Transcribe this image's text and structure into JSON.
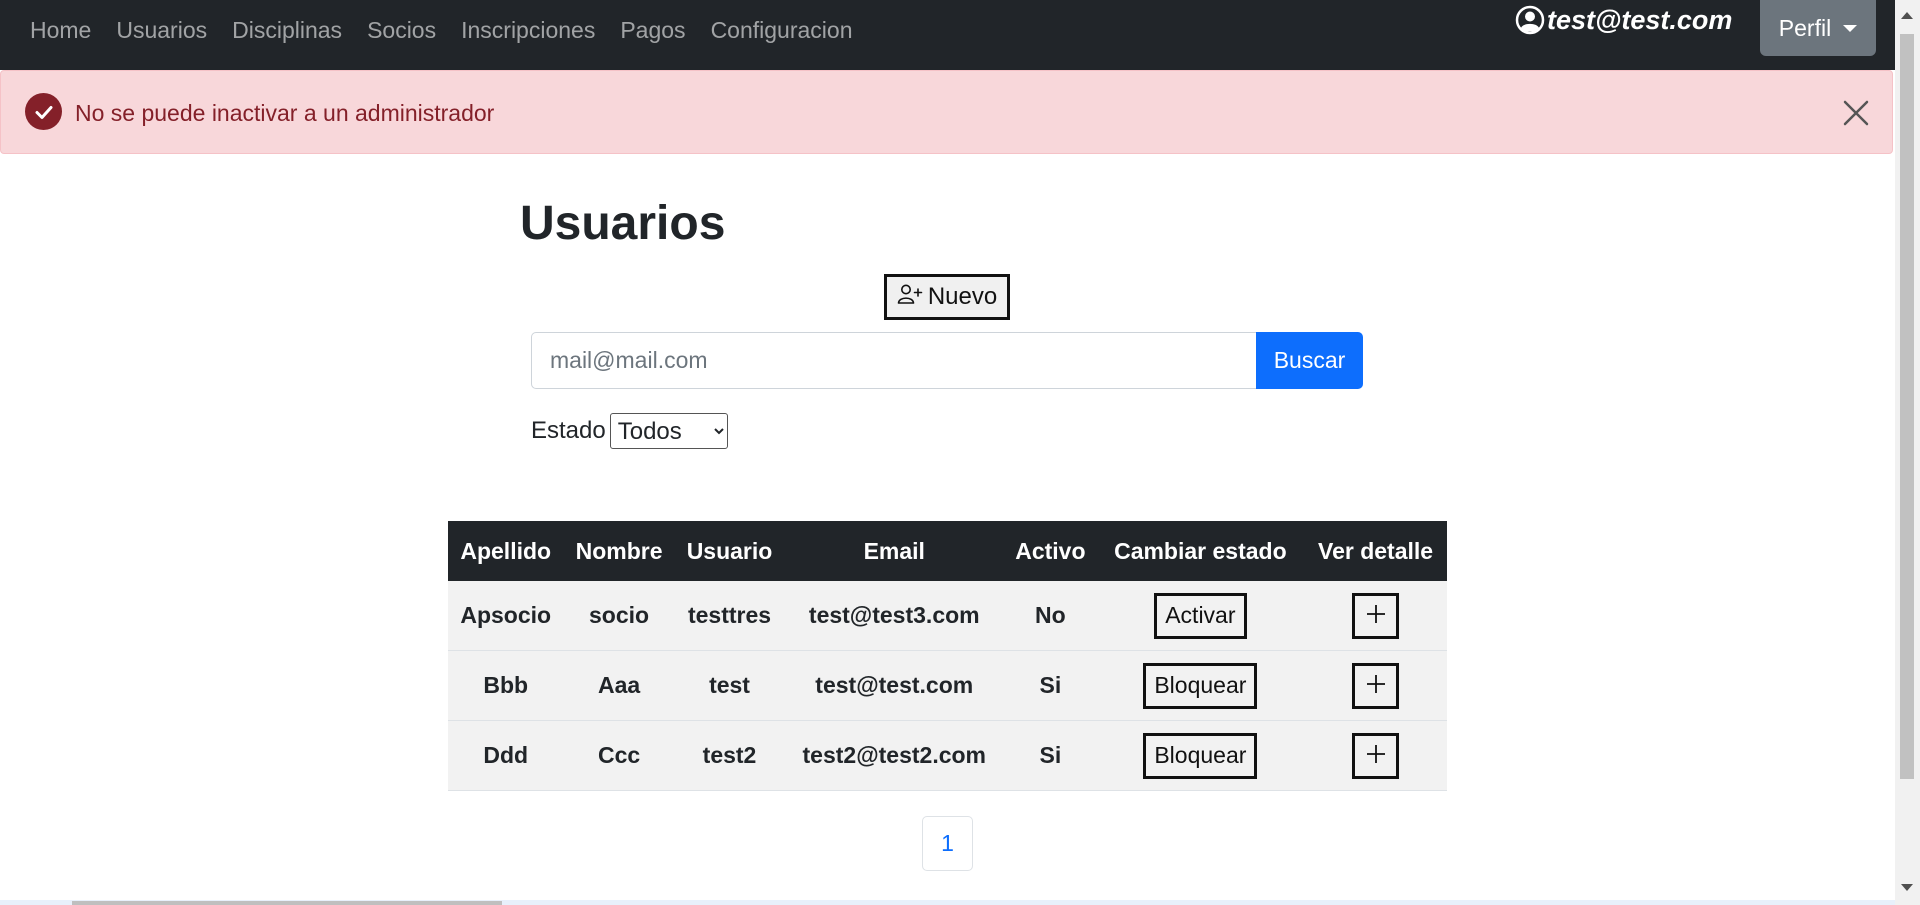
{
  "navbar": {
    "links": [
      "Home",
      "Usuarios",
      "Disciplinas",
      "Socios",
      "Inscripciones",
      "Pagos",
      "Configuracion"
    ],
    "user_email": "test@test.com",
    "profile_label": "Perfil",
    "user_icon": "user-circle-icon",
    "profile_icon": "caret-down-icon"
  },
  "alert": {
    "message": "No se puede inactivar a un administrador",
    "icon": "check-circle-icon",
    "close_icon": "close-icon",
    "color": "#842029",
    "background": "#f8d7da"
  },
  "page": {
    "title": "Usuarios"
  },
  "toolbar": {
    "new_label": "Nuevo",
    "new_icon": "person-plus-icon"
  },
  "search": {
    "placeholder": "mail@mail.com",
    "value": "",
    "button_label": "Buscar",
    "button_color": "#0d6efd"
  },
  "filter": {
    "label": "Estado",
    "selected": "Todos"
  },
  "table": {
    "headers": [
      "Apellido",
      "Nombre",
      "Usuario",
      "Email",
      "Activo",
      "Cambiar estado",
      "Ver detalle"
    ],
    "rows": [
      {
        "apellido": "Apsocio",
        "nombre": "socio",
        "usuario": "testtres",
        "email": "test@test3.com",
        "activo": "No",
        "accion": "Activar"
      },
      {
        "apellido": "Bbb",
        "nombre": "Aaa",
        "usuario": "test",
        "email": "test@test.com",
        "activo": "Si",
        "accion": "Bloquear"
      },
      {
        "apellido": "Ddd",
        "nombre": "Ccc",
        "usuario": "test2",
        "email": "test2@test2.com",
        "activo": "Si",
        "accion": "Bloquear"
      }
    ],
    "detail_icon": "plus-icon",
    "header_background": "#212529"
  },
  "pagination": {
    "current_page": "1"
  }
}
